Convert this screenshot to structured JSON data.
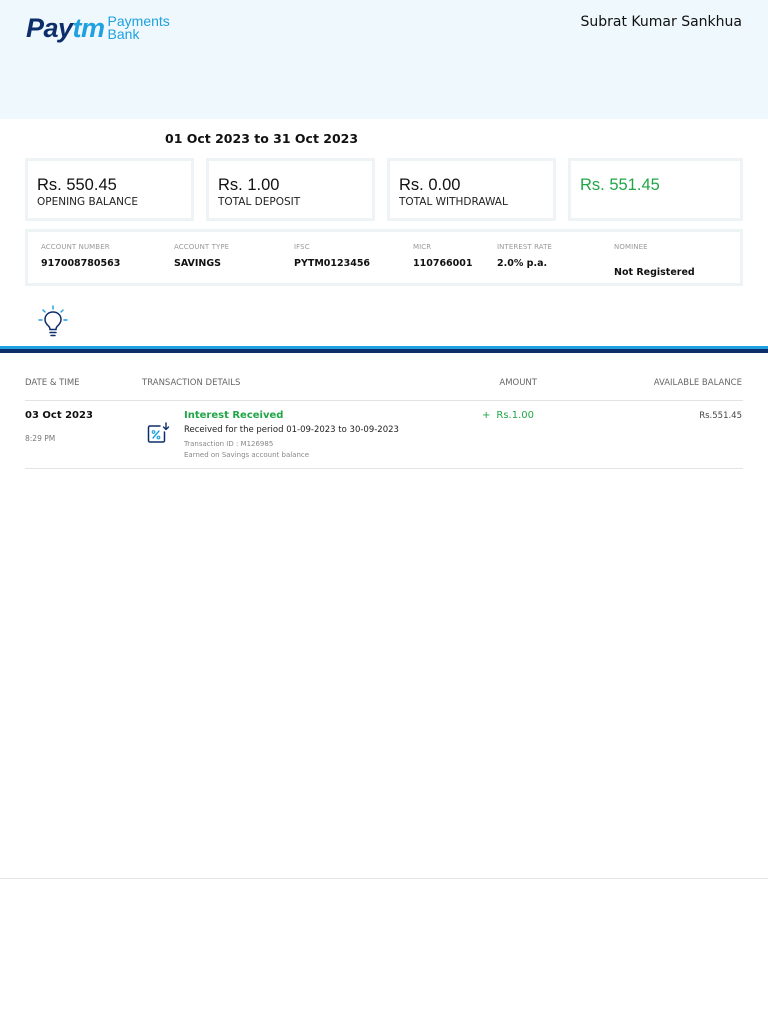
{
  "header": {
    "logo_paytm_p1": "Pay",
    "logo_paytm_p2": "tm",
    "logo_payments": "Payments",
    "logo_bank": "Bank",
    "account_holder": "Subrat Kumar Sankhua"
  },
  "statement_period": "01 Oct 2023 to 31 Oct 2023",
  "summary": {
    "opening_balance": {
      "amount": "Rs. 550.45",
      "label": "OPENING BALANCE"
    },
    "total_deposit": {
      "amount": "Rs. 1.00",
      "label": "TOTAL DEPOSIT"
    },
    "total_withdrawal": {
      "amount": "Rs. 0.00",
      "label": "TOTAL WITHDRAWAL"
    },
    "closing_balance": {
      "amount": "Rs. 551.45"
    }
  },
  "account": {
    "account_number": {
      "label": "ACCOUNT NUMBER",
      "value": "917008780563"
    },
    "account_type": {
      "label": "ACCOUNT TYPE",
      "value": "SAVINGS"
    },
    "ifsc": {
      "label": "IFSC",
      "value": "PYTM0123456"
    },
    "micr": {
      "label": "MICR",
      "value": "110766001"
    },
    "interest_rate": {
      "label": "INTEREST RATE",
      "value": "2.0% p.a."
    },
    "nominee": {
      "label": "NOMINEE",
      "value": "Not Registered"
    }
  },
  "table": {
    "headers": {
      "date_time": "DATE & TIME",
      "details": "TRANSACTION DETAILS",
      "amount": "AMOUNT",
      "available_balance": "AVAILABLE BALANCE"
    },
    "rows": [
      {
        "date": "03 Oct 2023",
        "time": "8:29 PM",
        "title": "Interest Received",
        "description": "Received for the period 01-09-2023 to 30-09-2023",
        "transaction_id": "Transaction ID : M126985",
        "note": "Earned on Savings account balance",
        "sign": "+",
        "amount": "Rs.1.00",
        "balance": "Rs.551.45"
      }
    ]
  },
  "colors": {
    "brand_navy": "#0d2e6b",
    "brand_blue": "#1fa0e0",
    "credit_green": "#21a647",
    "header_bg": "#eef8fd"
  },
  "icons": {
    "bulb": "lightbulb-icon",
    "transaction": "interest-percent-icon"
  }
}
